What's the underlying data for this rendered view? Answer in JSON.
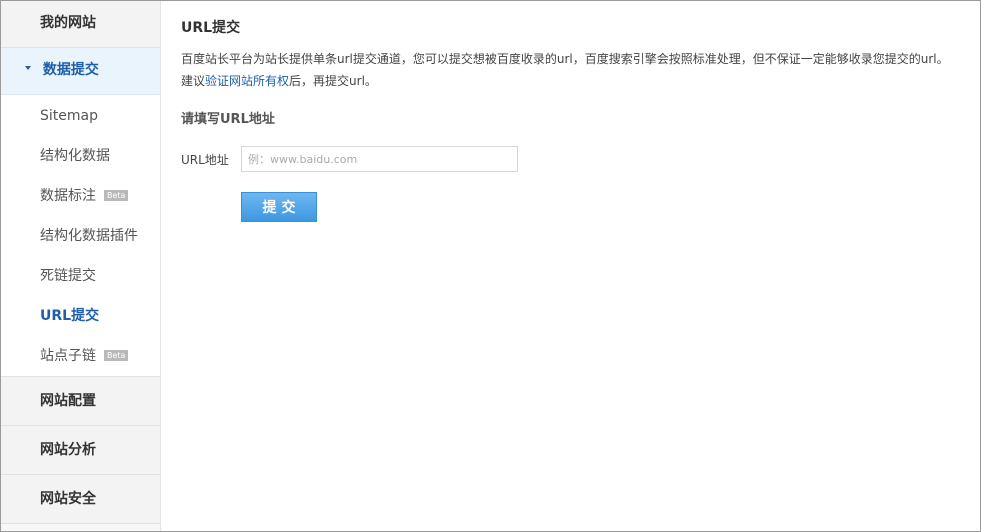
{
  "sidebar": {
    "groups": [
      {
        "label": "我的网站"
      },
      {
        "label": "数据提交"
      },
      {
        "label": "网站配置"
      },
      {
        "label": "网站分析"
      },
      {
        "label": "网站安全"
      }
    ],
    "sub_items": [
      {
        "label": "Sitemap"
      },
      {
        "label": "结构化数据"
      },
      {
        "label": "数据标注",
        "badge": "Beta"
      },
      {
        "label": "结构化数据插件"
      },
      {
        "label": "死链提交"
      },
      {
        "label": "URL提交"
      },
      {
        "label": "站点子链",
        "badge": "Beta"
      }
    ]
  },
  "main": {
    "title": "URL提交",
    "desc_line1": "百度站长平台为站长提供单条url提交通道，您可以提交想被百度收录的url，百度搜索引擎会按照标准处理，但不保证一定能够收录您提交的url。",
    "desc_prefix": "建议",
    "desc_link": "验证网站所有权",
    "desc_suffix": "后，再提交url。",
    "section_title": "请填写URL地址",
    "url_label": "URL地址",
    "url_placeholder": "例：www.baidu.com",
    "url_value": "",
    "submit_label": "提交"
  },
  "colors": {
    "accent": "#1f5fa8",
    "button": "#3c98e3"
  }
}
